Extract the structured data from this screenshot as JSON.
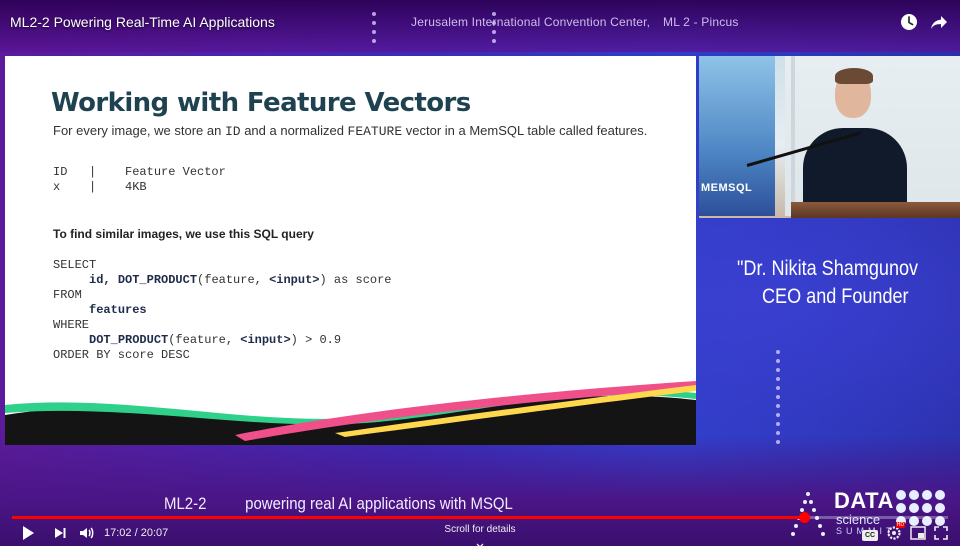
{
  "player": {
    "title": "ML2-2 Powering Real-Time AI Applications",
    "current_time": "17:02",
    "duration": "20:07",
    "time_separator": " / ",
    "progress_fraction": 0.846,
    "scroll_hint": "Scroll for details",
    "cc_label": "CC"
  },
  "banner": {
    "venue": "Jerusalem International Convention Center,",
    "room": "ML 2 - Pincus"
  },
  "slide": {
    "title": "Working with Feature Vectors",
    "intro_1": "For every image, we store an ",
    "intro_code_1": "ID",
    "intro_2": " and a normalized ",
    "intro_code_2": "FEATURE",
    "intro_3": " vector in a MemSQL table called features.",
    "table_header": "ID   |    Feature Vector",
    "table_row": "x    |    4KB",
    "query_intro": "To find similar images, we use this SQL query",
    "sql": {
      "l1": "SELECT",
      "l2_indent": "     ",
      "l2_bold": "id, DOT_PRODUCT",
      "l2_rest_a": "(feature, ",
      "l2_bold_b": "<input>",
      "l2_rest_b": ") as score",
      "l3": "FROM",
      "l4_indent": "     ",
      "l4_bold": "features",
      "l5": "WHERE",
      "l6_indent": "     ",
      "l6_bold": "DOT_PRODUCT",
      "l6_rest_a": "(feature, ",
      "l6_bold_b": "<input>",
      "l6_rest_b": ") > 0.9",
      "l7": "ORDER BY score DESC"
    }
  },
  "camera": {
    "screen_text": "MEMSQL"
  },
  "overlay": {
    "speaker_name": "\"Dr. Nikita Shamgunov",
    "speaker_role": "CEO and Founder",
    "session_code": "ML2-2",
    "session_title": "powering real AI applications with MSQL"
  },
  "logo": {
    "line1": "DATA",
    "line2": "science",
    "line3": "SUMMIT"
  },
  "colors": {
    "progress": "#ff0000",
    "slide_title": "#1f4250"
  }
}
